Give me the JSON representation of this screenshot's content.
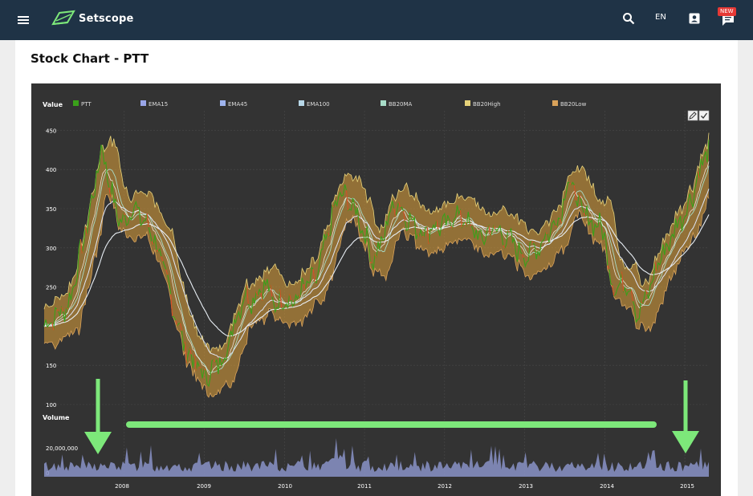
{
  "header": {
    "app_name": "Setscope",
    "language": "EN",
    "badge": "NEW"
  },
  "page": {
    "title": "Stock Chart - PTT"
  },
  "colors": {
    "header_bg": "#1f3346",
    "chart_bg": "#333333",
    "price_line": "#3aa01a",
    "band_fill": "#e0a23a",
    "accent_green": "#7de87a",
    "volume": "#8a93c8"
  },
  "icons": [
    "menu-icon",
    "logo-icon",
    "search-icon",
    "contact-icon",
    "chat-icon",
    "pen-icon",
    "check-icon",
    "arrow-down-icon"
  ],
  "chart_data": [
    {
      "type": "line",
      "ylabel": "Value",
      "yticks": [
        100,
        150,
        250,
        300,
        350,
        400,
        450
      ],
      "ylim": [
        100,
        475
      ],
      "xticks": [
        "2008",
        "2009",
        "2010",
        "2011",
        "2012",
        "2013",
        "2014",
        "2015"
      ],
      "xlim": [
        2007.0,
        2015.3
      ],
      "grid": true,
      "legend_position": "top",
      "legend": [
        {
          "name": "PTT",
          "color": "#3aa01a"
        },
        {
          "name": "EMA15",
          "color": "#9aa6e8"
        },
        {
          "name": "EMA45",
          "color": "#9fb4ee"
        },
        {
          "name": "EMA100",
          "color": "#b8d8e8"
        },
        {
          "name": "BB20MA",
          "color": "#a8dcc8"
        },
        {
          "name": "BB20High",
          "color": "#e6d27a"
        },
        {
          "name": "BB20Low",
          "color": "#d9a25a"
        }
      ],
      "price_points": [
        [
          2007.0,
          200
        ],
        [
          2007.1,
          210
        ],
        [
          2007.3,
          225
        ],
        [
          2007.45,
          290
        ],
        [
          2007.6,
          360
        ],
        [
          2007.72,
          430
        ],
        [
          2007.8,
          390
        ],
        [
          2007.9,
          345
        ],
        [
          2008.0,
          330
        ],
        [
          2008.1,
          355
        ],
        [
          2008.2,
          340
        ],
        [
          2008.35,
          320
        ],
        [
          2008.5,
          270
        ],
        [
          2008.6,
          230
        ],
        [
          2008.75,
          175
        ],
        [
          2008.9,
          150
        ],
        [
          2009.0,
          135
        ],
        [
          2009.1,
          145
        ],
        [
          2009.2,
          155
        ],
        [
          2009.3,
          175
        ],
        [
          2009.4,
          215
        ],
        [
          2009.5,
          240
        ],
        [
          2009.6,
          235
        ],
        [
          2009.75,
          255
        ],
        [
          2009.9,
          225
        ],
        [
          2010.0,
          240
        ],
        [
          2010.1,
          228
        ],
        [
          2010.25,
          250
        ],
        [
          2010.4,
          260
        ],
        [
          2010.5,
          300
        ],
        [
          2010.6,
          340
        ],
        [
          2010.7,
          370
        ],
        [
          2010.8,
          360
        ],
        [
          2010.9,
          345
        ],
        [
          2011.0,
          320
        ],
        [
          2011.1,
          285
        ],
        [
          2011.2,
          300
        ],
        [
          2011.3,
          340
        ],
        [
          2011.4,
          360
        ],
        [
          2011.5,
          345
        ],
        [
          2011.6,
          330
        ],
        [
          2011.75,
          320
        ],
        [
          2011.9,
          330
        ],
        [
          2012.0,
          325
        ],
        [
          2012.15,
          345
        ],
        [
          2012.3,
          330
        ],
        [
          2012.45,
          310
        ],
        [
          2012.6,
          325
        ],
        [
          2012.75,
          315
        ],
        [
          2012.9,
          300
        ],
        [
          2013.0,
          290
        ],
        [
          2013.15,
          300
        ],
        [
          2013.3,
          320
        ],
        [
          2013.45,
          345
        ],
        [
          2013.55,
          390
        ],
        [
          2013.62,
          370
        ],
        [
          2013.75,
          340
        ],
        [
          2013.9,
          330
        ],
        [
          2014.0,
          320
        ],
        [
          2014.08,
          255
        ],
        [
          2014.2,
          250
        ],
        [
          2014.3,
          260
        ],
        [
          2014.4,
          215
        ],
        [
          2014.5,
          230
        ],
        [
          2014.6,
          260
        ],
        [
          2014.7,
          290
        ],
        [
          2014.8,
          305
        ],
        [
          2014.9,
          330
        ],
        [
          2015.0,
          345
        ],
        [
          2015.1,
          370
        ],
        [
          2015.25,
          420
        ]
      ]
    },
    {
      "type": "bar",
      "ylabel": "Volume",
      "yticks": [
        "0",
        "20,000,000"
      ],
      "ylim": [
        0,
        40000000
      ],
      "xlim": [
        2007.0,
        2015.3
      ],
      "note_shapes": [
        "arrow-down-left",
        "arrow-down-right",
        "horizontal-bar"
      ]
    }
  ]
}
